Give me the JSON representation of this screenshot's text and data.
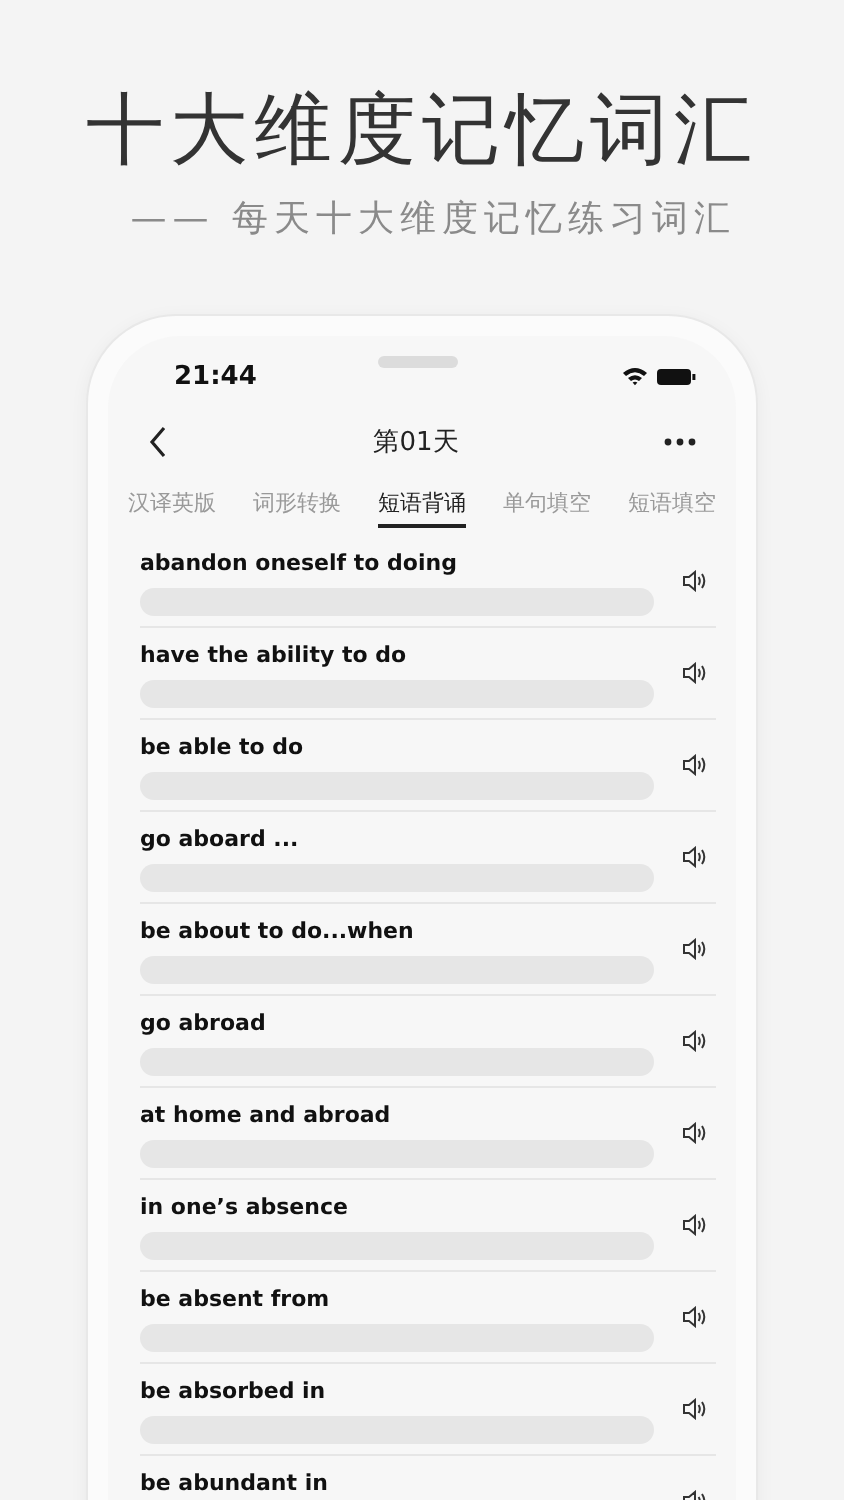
{
  "headline": "十大维度记忆词汇",
  "subtitle": "—— 每天十大维度记忆练习词汇",
  "status_bar": {
    "time": "21:44"
  },
  "nav": {
    "title": "第01天"
  },
  "tabs": [
    {
      "label": "汉译英版",
      "selected": false
    },
    {
      "label": "词形转换",
      "selected": false
    },
    {
      "label": "短语背诵",
      "selected": true
    },
    {
      "label": "单句填空",
      "selected": false
    },
    {
      "label": "短语填空",
      "selected": false
    }
  ],
  "phrases": [
    {
      "text": "abandon oneself to doing"
    },
    {
      "text": "have the ability to do"
    },
    {
      "text": "be able to do"
    },
    {
      "text": "go aboard ..."
    },
    {
      "text": "be about to do...when"
    },
    {
      "text": "go abroad"
    },
    {
      "text": "at home and abroad"
    },
    {
      "text": "in one’s absence"
    },
    {
      "text": "be absent from"
    },
    {
      "text": "be absorbed in"
    },
    {
      "text": "be abundant in"
    }
  ]
}
